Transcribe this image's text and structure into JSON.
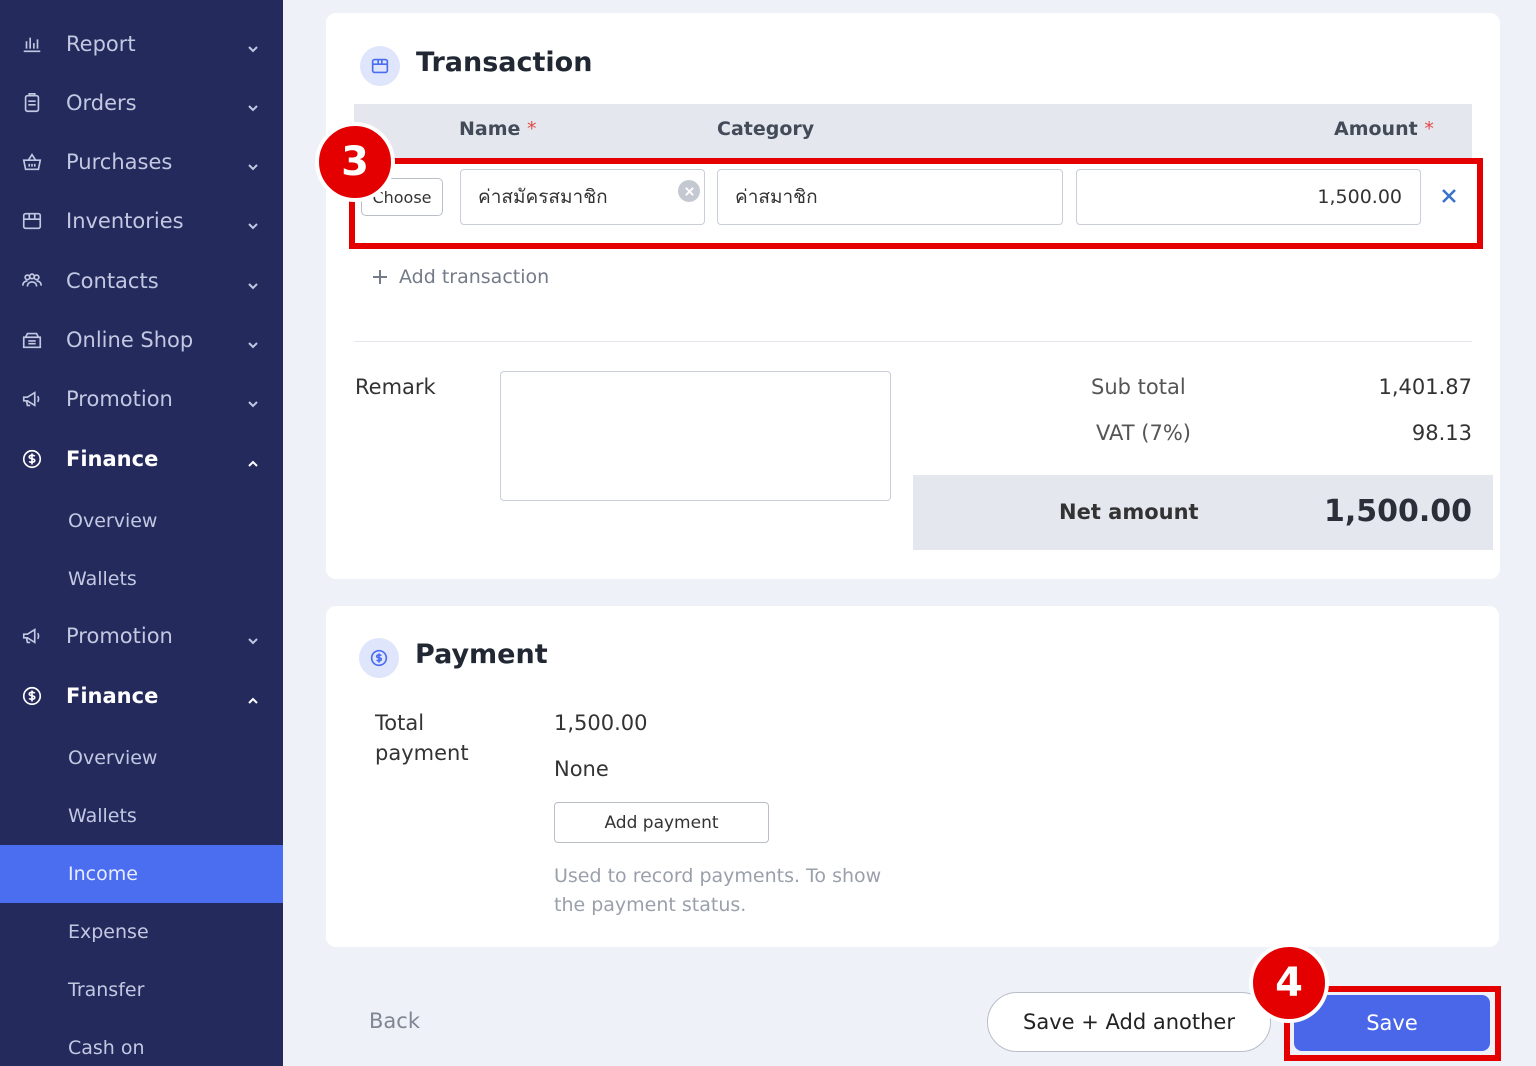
{
  "sidebar": {
    "items": [
      {
        "label": "Report",
        "icon": "bar-chart-icon"
      },
      {
        "label": "Orders",
        "icon": "clipboard-icon"
      },
      {
        "label": "Purchases",
        "icon": "basket-icon"
      },
      {
        "label": "Inventories",
        "icon": "box-icon"
      },
      {
        "label": "Contacts",
        "icon": "users-icon"
      },
      {
        "label": "Online Shop",
        "icon": "shop-icon"
      },
      {
        "label": "Promotion",
        "icon": "megaphone-icon"
      },
      {
        "label": "Finance",
        "icon": "dollar-circle-icon"
      },
      {
        "label": "Promotion",
        "icon": "megaphone-icon"
      },
      {
        "label": "Finance",
        "icon": "dollar-circle-icon"
      }
    ],
    "finance_sub_1": [
      "Overview",
      "Wallets"
    ],
    "finance_sub_2": [
      "Overview",
      "Wallets",
      "Income",
      "Expense",
      "Transfer",
      "Cash on"
    ],
    "active_item": "Income"
  },
  "transaction": {
    "title": "Transaction",
    "columns": {
      "name": "Name",
      "category": "Category",
      "amount": "Amount",
      "required_mark": "*"
    },
    "row": {
      "choose_label": "Choose",
      "name_value": "ค่าสมัครสมาชิก",
      "category_value": "ค่าสมาชิก",
      "amount_value": "1,500.00"
    },
    "add_label": "Add transaction",
    "remark_label": "Remark",
    "remark_value": "",
    "subtotal_label": "Sub total",
    "subtotal_value": "1,401.87",
    "vat_label": "VAT (7%)",
    "vat_value": "98.13",
    "net_label": "Net amount",
    "net_value": "1,500.00"
  },
  "payment": {
    "title": "Payment",
    "total_label_line1": "Total",
    "total_label_line2": "payment",
    "total_value": "1,500.00",
    "method_value": "None",
    "add_button": "Add payment",
    "help_line1": "Used to record payments. To show",
    "help_line2": "the payment status."
  },
  "footer": {
    "back_label": "Back",
    "save_add_label": "Save + Add another",
    "save_label": "Save"
  },
  "annotations": {
    "step3": "3",
    "step4": "4"
  },
  "colors": {
    "sidebar": "#242a5c",
    "accent": "#4b6ef0",
    "highlight": "#e50000"
  }
}
